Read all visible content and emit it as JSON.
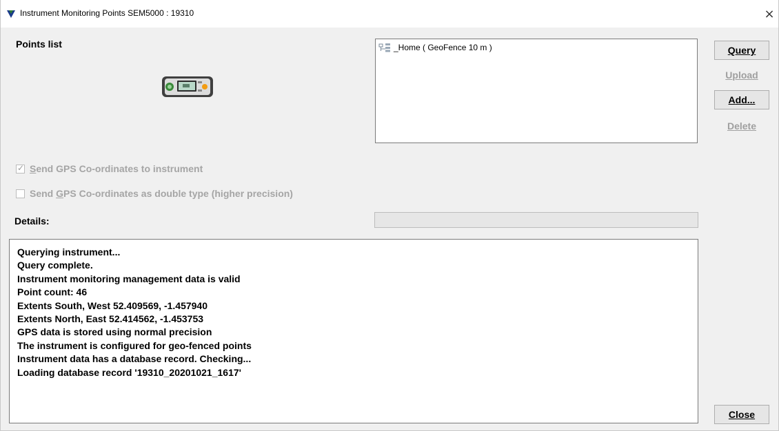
{
  "window": {
    "title": "Instrument Monitoring Points SEM5000 : 19310",
    "close_glyph": "×",
    "icon": "app-triangle-icon"
  },
  "points_list_label": "Points list",
  "points": [
    {
      "label": "_Home ( GeoFence 10 m )",
      "icon": "geofence-point-icon"
    }
  ],
  "buttons": {
    "query": {
      "mnemonic": "Q",
      "rest": "uery",
      "enabled": true
    },
    "upload": {
      "mnemonic": "U",
      "rest": "pload",
      "enabled": false
    },
    "add": {
      "mnemonic": "A",
      "rest": "dd...",
      "enabled": true
    },
    "delete": {
      "mnemonic": "D",
      "rest": "elete",
      "enabled": false
    },
    "close": {
      "mnemonic": "C",
      "rest": "lose",
      "enabled": true
    }
  },
  "checkboxes": [
    {
      "pre": "",
      "mnemonic": "S",
      "rest": "end GPS Co-ordinates to instrument",
      "checked": true,
      "enabled": false
    },
    {
      "pre": "Send ",
      "mnemonic": "G",
      "rest": "PS Co-ordinates as double type (higher precision)",
      "checked": false,
      "enabled": false
    }
  ],
  "details_label": "Details:",
  "progress": {
    "value": 0
  },
  "log_lines": [
    "Querying instrument...",
    "Query complete.",
    "Instrument monitoring management data is valid",
    "Point count: 46",
    "Extents South, West 52.409569, -1.457940",
    "Extents North, East 52.414562, -1.453753",
    "GPS data is stored using normal precision",
    "The instrument is configured for geo-fenced points",
    "Instrument data has a database record. Checking...",
    "Loading database record '19310_20201021_1617'"
  ],
  "colors": {
    "accent": "#1a3a8a",
    "disabled_text": "#a5a5a5",
    "window_bg": "#f0f0f0"
  }
}
